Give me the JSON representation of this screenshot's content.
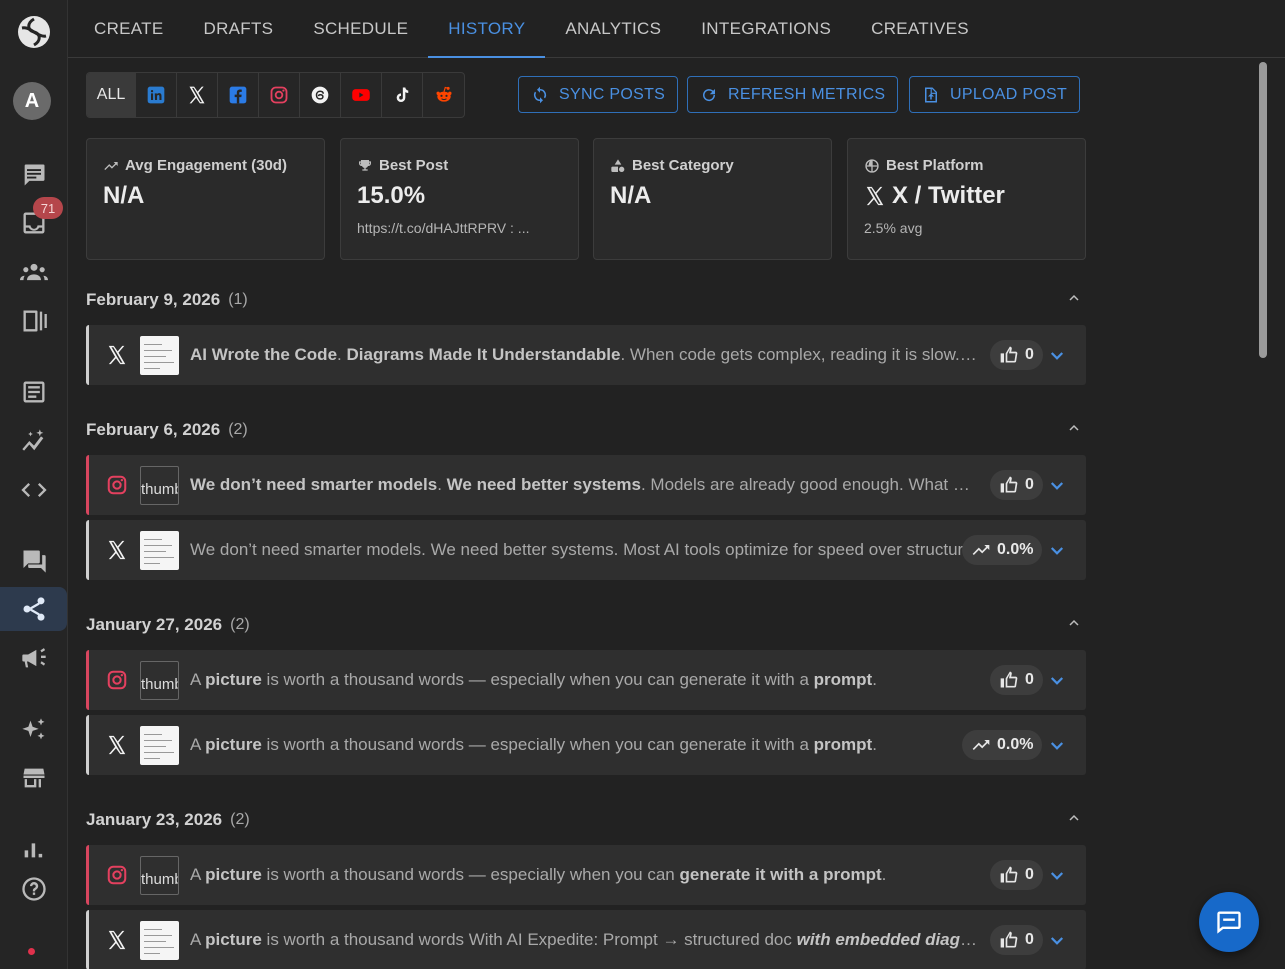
{
  "rail": {
    "avatar_initial": "A",
    "inbox_badge": "71"
  },
  "tabs": [
    {
      "label": "CREATE"
    },
    {
      "label": "DRAFTS"
    },
    {
      "label": "SCHEDULE"
    },
    {
      "label": "HISTORY",
      "active": true
    },
    {
      "label": "ANALYTICS"
    },
    {
      "label": "INTEGRATIONS"
    },
    {
      "label": "CREATIVES"
    }
  ],
  "filters": {
    "all_label": "ALL",
    "platforms": [
      "linkedin-icon",
      "x-icon",
      "facebook-icon",
      "instagram-icon",
      "threads-icon",
      "youtube-icon",
      "tiktok-icon",
      "reddit-icon"
    ]
  },
  "actions": {
    "sync": "SYNC POSTS",
    "refresh": "REFRESH METRICS",
    "upload": "UPLOAD POST"
  },
  "stats": {
    "avg_engagement": {
      "label": "Avg Engagement (30d)",
      "value": "N/A"
    },
    "best_post": {
      "label": "Best Post",
      "value": "15.0%",
      "sub": "https://t.co/dHAJttRPRV : ..."
    },
    "best_category": {
      "label": "Best Category",
      "value": "N/A"
    },
    "best_platform": {
      "label": "Best Platform",
      "value": "X / Twitter",
      "sub": "2.5% avg"
    }
  },
  "groups": [
    {
      "date": "February 9, 2026",
      "count": "(1)",
      "posts": [
        {
          "platform": "x",
          "text_html": "<b>AI Wrote the Code</b>. <b>Diagrams Made It Understandable</b>. When code gets complex, reading it is slow. Diagrams show the structure.",
          "metric": "0",
          "metric_type": "likes"
        }
      ]
    },
    {
      "date": "February 6, 2026",
      "count": "(2)",
      "posts": [
        {
          "platform": "instagram",
          "text_html": "<b>We don’t need smarter models</b>. <b>We need better systems</b>. Models are already good enough. What matters is the system around them.",
          "metric": "0",
          "metric_type": "likes",
          "thumb_alt": "thumbnail"
        },
        {
          "platform": "x",
          "text_html": "We don’t need smarter models. We need better systems. Most AI tools optimize for speed over structure.",
          "metric": "0.0%",
          "metric_type": "engagement"
        }
      ]
    },
    {
      "date": "January 27, 2026",
      "count": "(2)",
      "posts": [
        {
          "platform": "instagram",
          "text_html": "A <b>picture</b> is worth a thousand words — especially when you can generate it with a <b>prompt</b>.",
          "metric": "0",
          "metric_type": "likes",
          "thumb_alt": "thumbnail"
        },
        {
          "platform": "x",
          "text_html": "A <b>picture</b> is worth a thousand words — especially when you can generate it with a <b>prompt</b>.",
          "metric": "0.0%",
          "metric_type": "engagement"
        }
      ]
    },
    {
      "date": "January 23, 2026",
      "count": "(2)",
      "posts": [
        {
          "platform": "instagram",
          "text_html": "A <b>picture</b> is worth a thousand words — especially when you can <b>generate it with a prompt</b>.",
          "metric": "0",
          "metric_type": "likes",
          "thumb_alt": "thumbnail"
        },
        {
          "platform": "x",
          "text_html": "A <b>picture</b> is worth a thousand words With AI Expedite: Prompt → structured doc <b><i>with embedded diagrams</i></b>",
          "metric": "0",
          "metric_type": "likes"
        }
      ]
    }
  ],
  "colors": {
    "accent": "#4a90e2",
    "instagram_border": "#d9465f",
    "badge": "#b5464b"
  }
}
